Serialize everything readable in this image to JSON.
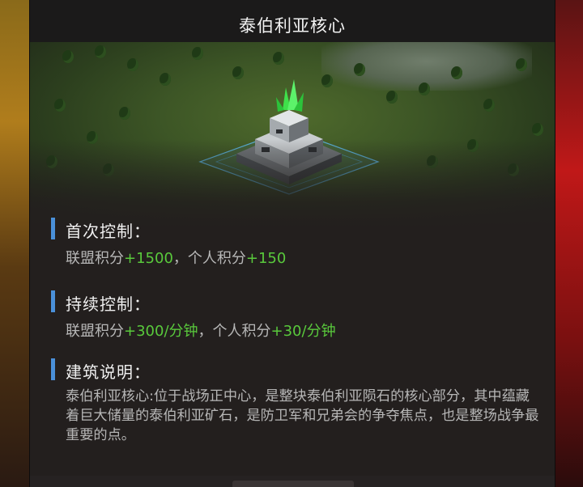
{
  "dialog": {
    "title": "泰伯利亚核心"
  },
  "building": {
    "icon": "tiberium-core-building-icon"
  },
  "sections": {
    "first_control": {
      "heading": "首次控制：",
      "alliance_label": "联盟积分",
      "alliance_value": "+1500",
      "separator": "，",
      "personal_label": "个人积分",
      "personal_value": "+150"
    },
    "sustained_control": {
      "heading": "持续控制：",
      "alliance_label": "联盟积分",
      "alliance_value": "+300/分钟",
      "separator": "，",
      "personal_label": "个人积分",
      "personal_value": "+30/分钟"
    },
    "description": {
      "heading": "建筑说明：",
      "text": "泰伯利亚核心:位于战场正中心，是整块泰伯利亚陨石的核心部分，其中蕴藏着巨大储量的泰伯利亚矿石，是防卫军和兄弟会的争夺焦点，也是整场战争最重要的点。"
    }
  },
  "colors": {
    "accent_bar": "#4a90d9",
    "value_green": "#59c93c",
    "crystal_green": "#3fe04a"
  }
}
